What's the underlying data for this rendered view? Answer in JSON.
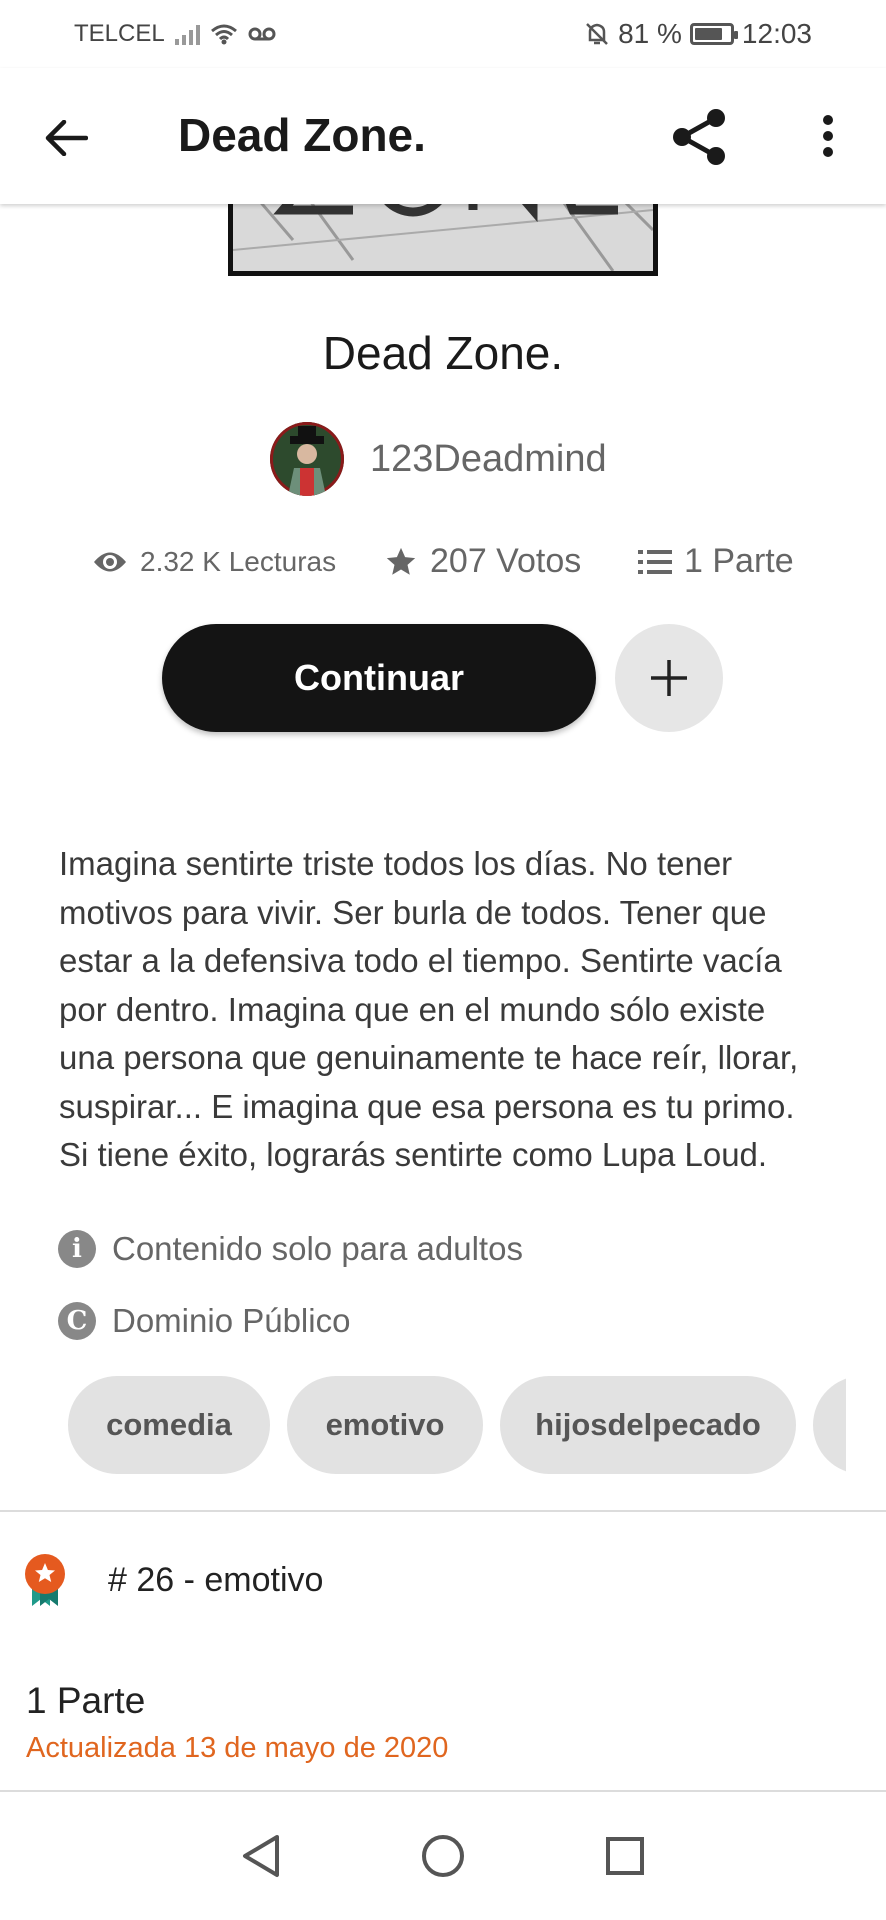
{
  "status_bar": {
    "carrier": "TELCEL",
    "battery": "81 %",
    "battery_level": 0.81,
    "time": "12:03"
  },
  "app_bar": {
    "title": "Dead Zone."
  },
  "story": {
    "title": "Dead Zone.",
    "author": "123Deadmind",
    "stats": {
      "reads": "2.32 K Lecturas",
      "votes": "207 Votos",
      "parts": "1 Parte"
    },
    "continue_label": "Continuar",
    "description_lines": [
      "Imagina sentirte triste todos los días. No tener",
      "motivos para vivir. Ser burla de todos. Tener que",
      "estar a la defensiva todo el tiempo. Sentirte vacía",
      "por dentro. Imagina que en el mundo sólo existe",
      "una persona que genuinamente te hace reír, llorar,",
      "suspirar... E imagina que esa persona es tu primo.",
      "Si tiene éxito, lograrás sentirte como Lupa Loud."
    ],
    "mature_label": "Contenido solo para adultos",
    "license_label": "Dominio Público",
    "tags": [
      "comedia",
      "emotivo",
      "hijosdelpecado"
    ],
    "ranking": "# 26 - emotivo",
    "parts_count": "1 Parte",
    "updated": "Actualizada 13 de mayo de 2020"
  },
  "colors": {
    "accent": "#e0661f",
    "button_dark": "#141414",
    "chip_bg": "#e2e2e2"
  },
  "icons": [
    "back-arrow",
    "share",
    "more-vertical",
    "eye",
    "star",
    "list",
    "plus",
    "info",
    "copyright",
    "award-ribbon",
    "nav-back-triangle",
    "nav-home-circle",
    "nav-recents-square"
  ]
}
